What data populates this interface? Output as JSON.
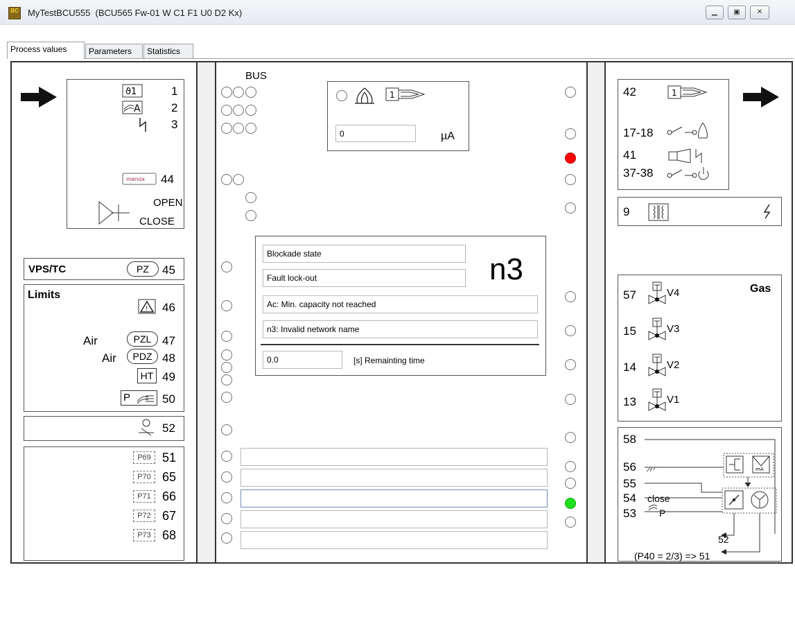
{
  "window": {
    "icon_text": "BC",
    "title": "MyTestBCU555  (BCU565 Fw-01 W C1 F1 U0 D2 Kx)"
  },
  "tabs": [
    "Process values",
    "Parameters",
    "Statistics"
  ],
  "inputs": {
    "rows": [
      {
        "num": "1"
      },
      {
        "num": "2"
      },
      {
        "num": "3"
      },
      {
        "num": "44"
      }
    ],
    "open": "OPEN",
    "close": "CLOSE"
  },
  "vps": {
    "label": "VPS/TC",
    "pz": "PZ",
    "num": "45"
  },
  "limits": {
    "title": "Limits",
    "n46": "46",
    "air1": "Air",
    "pzl": "PZL",
    "n47": "47",
    "air2": "Air",
    "pdz": "PDZ",
    "n48": "48",
    "ht": "HT",
    "n49": "49",
    "p": "P",
    "n50": "50"
  },
  "n52": "52",
  "params": [
    {
      "p": "P69",
      "n": "51"
    },
    {
      "p": "P70",
      "n": "65"
    },
    {
      "p": "P71",
      "n": "66"
    },
    {
      "p": "P72",
      "n": "67"
    },
    {
      "p": "P73",
      "n": "68"
    }
  ],
  "center": {
    "bus": "BUS",
    "ionisation_value": "0",
    "ionisation_unit": "µA"
  },
  "status": {
    "blockade": "Blockade state",
    "fault": "Fault lock-out",
    "code": "n3",
    "msg1": "Ac: Min. capacity not reached",
    "msg2": "n3: Invalid network name",
    "remaining_value": "0.0",
    "remaining_label": "[s] Remainting time"
  },
  "outputs": {
    "n42": "42",
    "n1718": "17-18",
    "n41": "41",
    "n3738": "37-38",
    "n9": "9"
  },
  "gas": {
    "title": "Gas",
    "valves": [
      {
        "n": "57",
        "label": "V4"
      },
      {
        "n": "15",
        "label": "V3"
      },
      {
        "n": "14",
        "label": "V2"
      },
      {
        "n": "13",
        "label": "V1"
      }
    ]
  },
  "connect": {
    "n58": "58",
    "n56": "56",
    "n55": "55",
    "n54": "54",
    "close": "close",
    "n53": "53",
    "p": "P",
    "r52": "52",
    "p40": "(P40 = 2/3) => 51",
    "ma": "mA"
  },
  "colors": {
    "led_red": "#ff0000",
    "led_green": "#20e020",
    "frame": "#444444",
    "panel_bg": "#f0f0f0"
  }
}
